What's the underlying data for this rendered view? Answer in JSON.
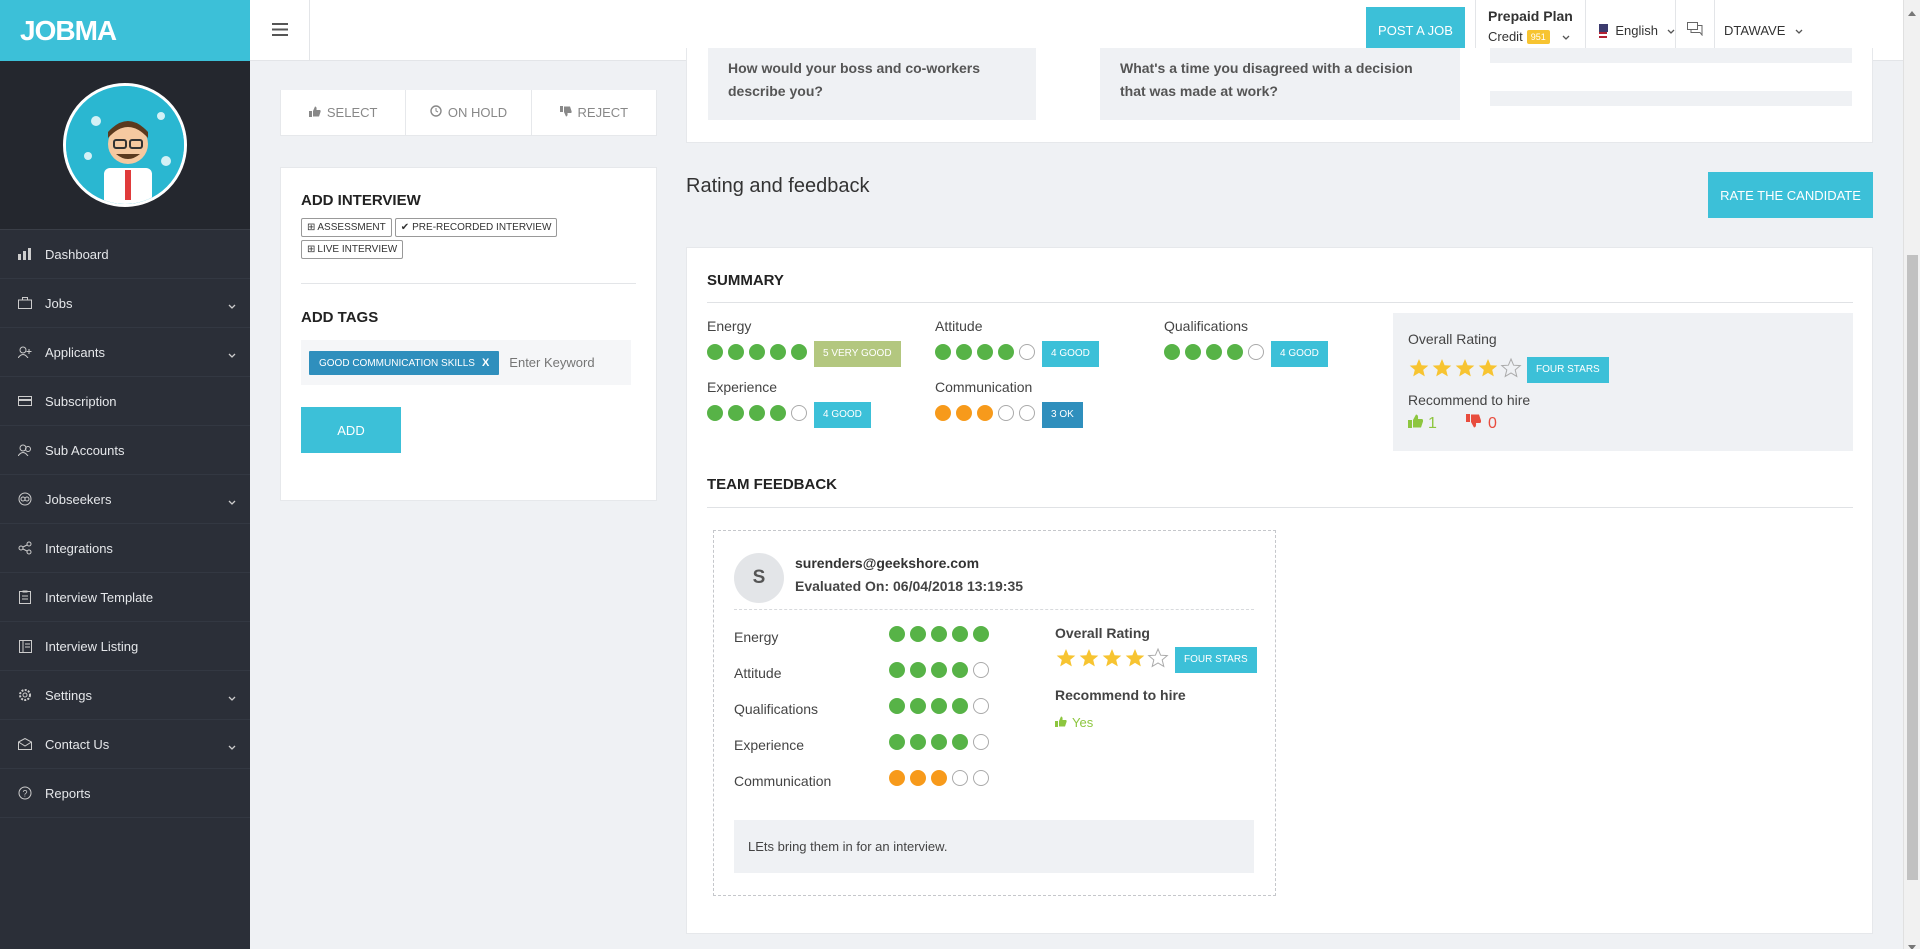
{
  "brand": {
    "logo": "JOBMA"
  },
  "sidebar": {
    "items": [
      {
        "label": "Dashboard",
        "icon": "bar-chart-icon",
        "has_children": false
      },
      {
        "label": "Jobs",
        "icon": "briefcase-icon",
        "has_children": true
      },
      {
        "label": "Applicants",
        "icon": "user-plus-icon",
        "has_children": true
      },
      {
        "label": "Subscription",
        "icon": "credit-card-icon",
        "has_children": false
      },
      {
        "label": "Sub Accounts",
        "icon": "users-icon",
        "has_children": false
      },
      {
        "label": "Jobseekers",
        "icon": "jobseekers-icon",
        "has_children": true
      },
      {
        "label": "Integrations",
        "icon": "share-icon",
        "has_children": false
      },
      {
        "label": "Interview Template",
        "icon": "clipboard-icon",
        "has_children": false
      },
      {
        "label": "Interview Listing",
        "icon": "book-icon",
        "has_children": false
      },
      {
        "label": "Settings",
        "icon": "gear-icon",
        "has_children": true
      },
      {
        "label": "Contact Us",
        "icon": "envelope-icon",
        "has_children": true
      },
      {
        "label": "Reports",
        "icon": "question-icon",
        "has_children": false
      }
    ]
  },
  "topbar": {
    "post_job": "POST A JOB",
    "plan_title": "Prepaid Plan",
    "credit_label": "Credit",
    "credit_value": "951",
    "language": "English",
    "user": "DTAWAVE"
  },
  "actions": {
    "select": "SELECT",
    "on_hold": "ON HOLD",
    "reject": "REJECT"
  },
  "add_interview": {
    "title": "ADD INTERVIEW",
    "chips": [
      "ASSESSMENT",
      "PRE-RECORDED INTERVIEW",
      "LIVE INTERVIEW"
    ]
  },
  "add_tags": {
    "title": "ADD TAGS",
    "tag": "GOOD COMMUNICATION SKILLS",
    "tag_remove": "x",
    "placeholder": "Enter Keyword",
    "add_button": "ADD"
  },
  "questions": [
    "How would your boss and co-workers describe you?",
    "What's a time you disagreed with a decision that was made at work?"
  ],
  "rating": {
    "title": "Rating and feedback",
    "rate_button": "RATE THE CANDIDATE",
    "summary_title": "SUMMARY",
    "criteria": [
      {
        "label": "Energy",
        "score": 5,
        "badge": "5 VERY GOOD",
        "color": "#b3c77f"
      },
      {
        "label": "Attitude",
        "score": 4,
        "badge": "4 GOOD",
        "color": "#3cc0d8"
      },
      {
        "label": "Qualifications",
        "score": 4,
        "badge": "4 GOOD",
        "color": "#3cc0d8"
      },
      {
        "label": "Experience",
        "score": 4,
        "badge": "4 GOOD",
        "color": "#3cc0d8"
      },
      {
        "label": "Communication",
        "score": 3,
        "badge": "3 OK",
        "color": "#2f8fbd"
      }
    ],
    "overall": {
      "label": "Overall Rating",
      "stars": 4,
      "max_stars": 5,
      "badge": "FOUR STARS",
      "recommend_label": "Recommend to hire",
      "yes_count": "1",
      "no_count": "0"
    },
    "team_feedback_title": "TEAM FEEDBACK",
    "feedback": {
      "initial": "S",
      "email": "surenders@geekshore.com",
      "evaluated": "Evaluated On: 06/04/2018 13:19:35",
      "overall_label": "Overall Rating",
      "stars": 4,
      "badge": "FOUR STARS",
      "recommend_label": "Recommend to hire",
      "recommend_value": "Yes",
      "comment": "LEts bring them in for an interview."
    }
  },
  "colors": {
    "accent": "#3cc0d8",
    "green": "#57b347",
    "orange": "#f79a1b",
    "star": "#f7c431",
    "dislike": "#e84c3d",
    "like": "#8dc63f"
  }
}
